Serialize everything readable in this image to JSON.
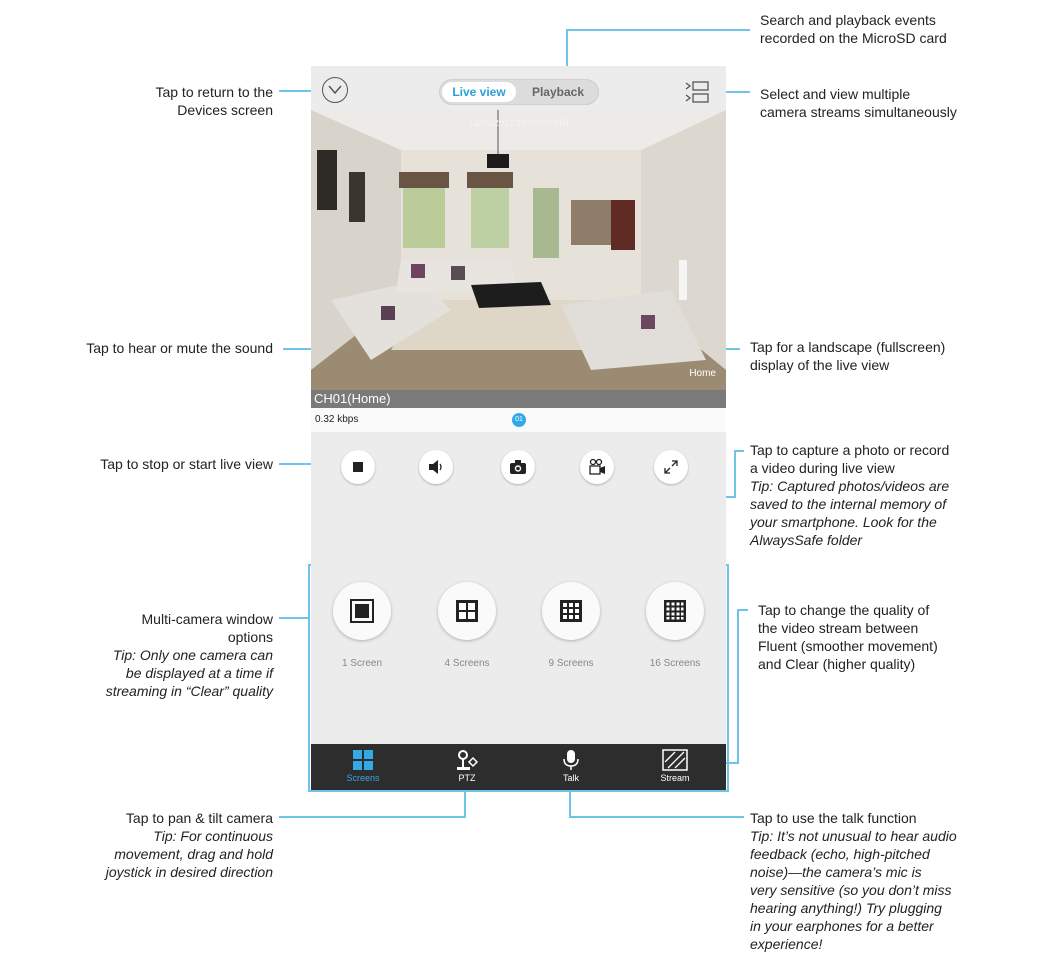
{
  "app": {
    "tabs": {
      "live": "Live view",
      "playback": "Playback"
    },
    "timestamp": "12/05/2017 10:00:00 FRI",
    "camera_name": "Home",
    "channel_label": "CH01(Home)",
    "bitrate": "0.32 kbps",
    "page_indicator": "01",
    "grid_options": [
      "1 Screen",
      "4 Screens",
      "9 Screens",
      "16 Screens"
    ],
    "bottom_tabs": [
      "Screens",
      "PTZ",
      "Talk",
      "Stream"
    ]
  },
  "annotations": {
    "return": [
      "Tap to return to the",
      "Devices screen"
    ],
    "search": [
      "Search and playback events",
      "recorded on the MicroSD card"
    ],
    "multi": [
      "Select and view multiple",
      "camera streams simultaneously"
    ],
    "sound": "Tap to hear or mute the sound",
    "landscape": [
      "Tap for a landscape (fullscreen)",
      "display of the live view"
    ],
    "stop": "Tap to stop or start live view",
    "capture": [
      "Tap to capture a photo or record",
      "a video during live view"
    ],
    "capture_tip": [
      "Tip: Captured photos/videos are",
      "saved to the internal memory of",
      "your smartphone. Look for the",
      "AlwaysSafe folder"
    ],
    "window": [
      "Multi-camera window",
      "options"
    ],
    "window_tip": [
      "Tip: Only one camera can",
      "be displayed at a time if",
      "streaming in “Clear” quality"
    ],
    "quality": [
      "Tap to change the quality of",
      "the video stream between",
      "Fluent (smoother movement)",
      "and Clear (higher quality)"
    ],
    "pan": "Tap to pan & tilt camera",
    "pan_tip": [
      "Tip: For continuous",
      "movement, drag and hold",
      "joystick in desired direction"
    ],
    "talk": "Tap to use the talk function",
    "talk_tip": [
      "Tip: It’s not unusual to hear audio",
      "feedback (echo, high-pitched",
      "noise)—the camera’s mic is",
      "very sensitive (so you don’t miss",
      "hearing anything!) Try plugging",
      "in your earphones for a better",
      "experience!"
    ]
  },
  "colors": {
    "accent": "#33a9e8",
    "callout_line": "#6fc3e6",
    "tabbar": "#2d2d2d"
  },
  "icons": [
    "chevron-down-icon",
    "multi-view-icon",
    "stop-icon",
    "speaker-icon",
    "camera-icon",
    "video-record-icon",
    "fullscreen-icon",
    "screens-icon",
    "ptz-icon",
    "microphone-icon",
    "stream-icon"
  ]
}
